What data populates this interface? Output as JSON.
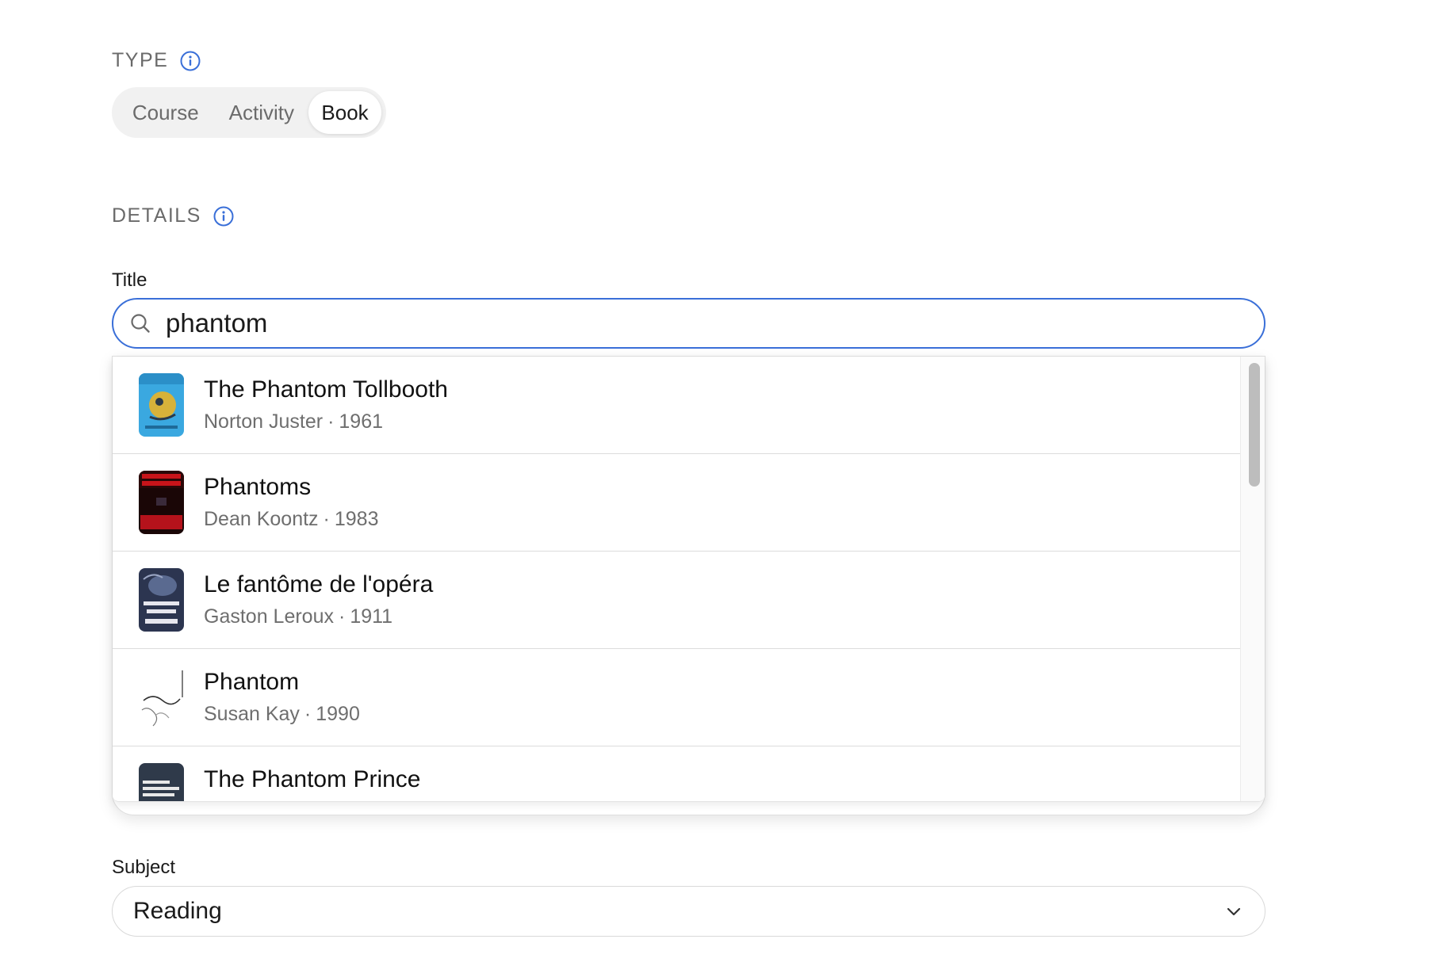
{
  "type_section": {
    "label": "TYPE",
    "info_icon": "info-icon",
    "options": [
      "Course",
      "Activity",
      "Book"
    ],
    "selected": "Book"
  },
  "details_section": {
    "label": "DETAILS",
    "info_icon": "info-icon"
  },
  "title_field": {
    "label": "Title",
    "value": "phantom",
    "icon": "search-icon",
    "accent_color": "#3a6fd8"
  },
  "results": [
    {
      "title": "The Phantom Tollbooth",
      "author": "Norton Juster",
      "year": "1961"
    },
    {
      "title": "Phantoms",
      "author": "Dean Koontz",
      "year": "1983"
    },
    {
      "title": "Le fantôme de l'opéra",
      "author": "Gaston Leroux",
      "year": "1911"
    },
    {
      "title": "Phantom",
      "author": "Susan Kay",
      "year": "1990"
    },
    {
      "title": "The Phantom Prince",
      "author": "",
      "year": ""
    }
  ],
  "meta_separator": "·",
  "subject_field": {
    "label": "Subject",
    "value": "Reading",
    "icon": "chevron-down-icon"
  }
}
